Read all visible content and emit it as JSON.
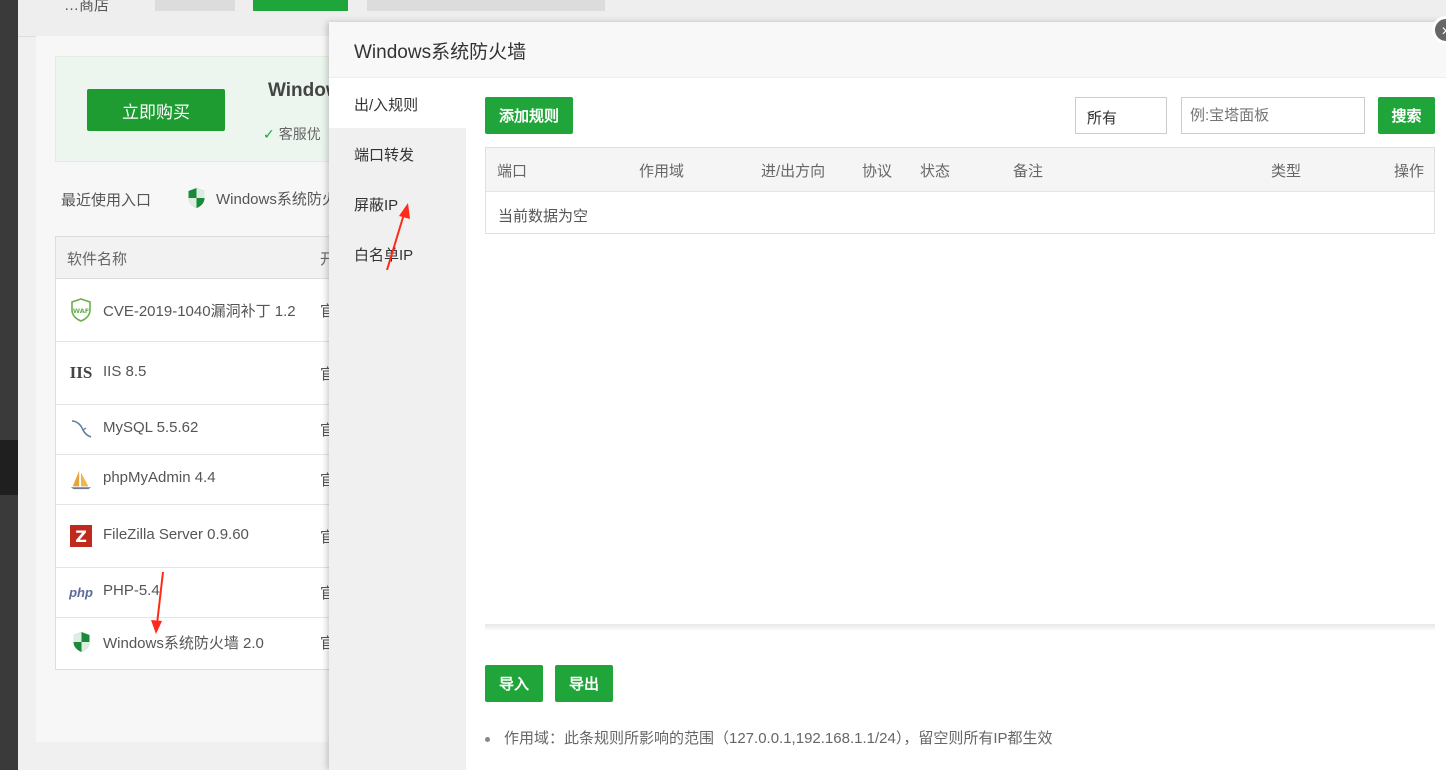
{
  "background": {
    "header_text": "…商店",
    "promo": {
      "buy_button": "立即购买",
      "title": "Window",
      "subtitle": "客服优"
    },
    "recent": {
      "label": "最近使用入口",
      "item": "Windows系统防火"
    },
    "software_table": {
      "col_name": "软件名称",
      "col_src": "开",
      "rows": [
        {
          "icon": "waf-icon",
          "name": "CVE-2019-1040漏洞补丁 1.2",
          "src": "官"
        },
        {
          "icon": "iis-icon",
          "name": "IIS 8.5",
          "src": "官"
        },
        {
          "icon": "mysql-icon",
          "name": "MySQL 5.5.62",
          "src": "官"
        },
        {
          "icon": "phpmyadmin-icon",
          "name": "phpMyAdmin 4.4",
          "src": "官"
        },
        {
          "icon": "filezilla-icon",
          "name": "FileZilla Server 0.9.60",
          "src": "官"
        },
        {
          "icon": "php-icon",
          "name": "PHP-5.4",
          "src": "官"
        },
        {
          "icon": "shield-icon",
          "name": "Windows系统防火墙 2.0",
          "src": "官"
        }
      ]
    }
  },
  "modal": {
    "title": "Windows系统防火墙",
    "close": "×",
    "menu": [
      "出/入规则",
      "端口转发",
      "屏蔽IP",
      "白名单IP"
    ],
    "active_menu": 0,
    "add_rule": "添加规则",
    "filter_selected": "所有",
    "search_placeholder": "例:宝塔面板",
    "search_button": "搜索",
    "table_headers": [
      "端口",
      "作用域",
      "进/出方向",
      "协议",
      "状态",
      "备注",
      "类型",
      "操作"
    ],
    "empty_text": "当前数据为空",
    "import_button": "导入",
    "export_button": "导出",
    "note": "作用域：此条规则所影响的范围（127.0.0.1,192.168.1.1/24），留空则所有IP都生效"
  },
  "colors": {
    "accent": "#20a53a",
    "annotation_arrow": "#ff2a1a"
  }
}
